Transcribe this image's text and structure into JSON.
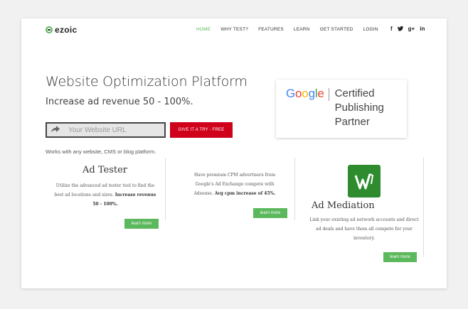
{
  "brand": {
    "name": "ezoic"
  },
  "nav": {
    "items": [
      "HOME",
      "WHY TEST?",
      "FEATURES",
      "LEARN",
      "GET STARTED",
      "LOGIN"
    ],
    "active": "HOME"
  },
  "social": [
    "f",
    "t",
    "g+",
    "in"
  ],
  "hero": {
    "headline": "Website Optimization Platform",
    "subhead": "Increase ad revenue 50 - 100%.",
    "url_placeholder": "Your Website URL",
    "try_button": "GIVE IT A TRY - FREE",
    "works_text": "Works with any website, CMS or blog platform."
  },
  "certified": {
    "google": "Google",
    "line1": "Certified",
    "line2": "Publishing",
    "line3": "Partner"
  },
  "features": {
    "ad_tester": {
      "title": "Ad Tester",
      "desc": "Utilize the advanced ad tester tool to find the best ad locations and sizes.",
      "desc_bold": "Increase revenue 50 - 100%.",
      "button": "learn more"
    },
    "cpm": {
      "desc": "Have premium CPM advertisers from Google's Ad Exchange compete with Adsense.",
      "desc_bold": "Avg cpm increase of 45%.",
      "button": "learn more"
    },
    "mediation": {
      "title": "Ad Mediation",
      "desc": "Link your existing ad network accounts and direct ad deals and have them all compete for your inventory.",
      "button": "learn more"
    }
  },
  "colors": {
    "accent_green": "#5cb85c",
    "cta_red": "#d0021b"
  }
}
